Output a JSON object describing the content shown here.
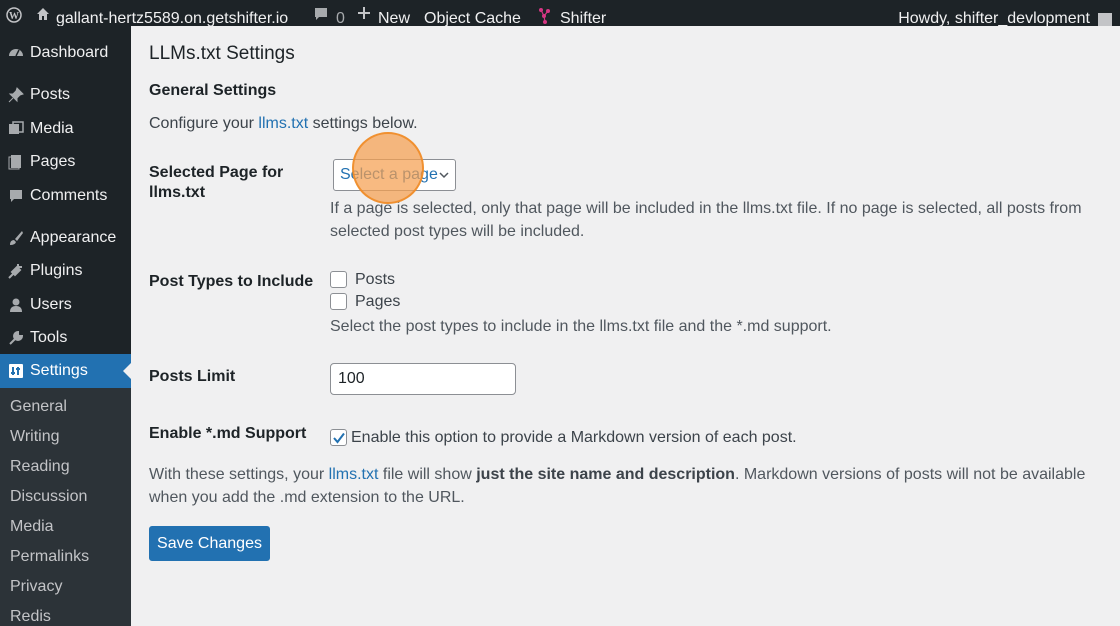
{
  "admin_bar": {
    "site_name": "gallant-hertz5589.on.getshifter.io",
    "comment_count": "0",
    "new_label": "New",
    "object_cache_label": "Object Cache",
    "shifter_label": "Shifter",
    "howdy_label": "Howdy, shifter_devlopment"
  },
  "sidebar": {
    "items": [
      {
        "label": "Dashboard",
        "icon": "dashboard-icon"
      },
      {
        "label": "Posts",
        "icon": "pin-icon"
      },
      {
        "label": "Media",
        "icon": "media-icon"
      },
      {
        "label": "Pages",
        "icon": "pages-icon"
      },
      {
        "label": "Comments",
        "icon": "comment-icon"
      },
      {
        "label": "Appearance",
        "icon": "brush-icon"
      },
      {
        "label": "Plugins",
        "icon": "plug-icon"
      },
      {
        "label": "Users",
        "icon": "user-icon"
      },
      {
        "label": "Tools",
        "icon": "wrench-icon"
      },
      {
        "label": "Settings",
        "icon": "settings-icon"
      }
    ],
    "submenu": [
      "General",
      "Writing",
      "Reading",
      "Discussion",
      "Media",
      "Permalinks",
      "Privacy",
      "Redis"
    ]
  },
  "page": {
    "title": "LLMs.txt Settings",
    "section_title": "General Settings",
    "intro_before": "Configure your ",
    "intro_link": "llms.txt",
    "intro_after": " settings below.",
    "selected_page": {
      "label_line1": "Selected Page for",
      "label_line2": "llms.txt",
      "placeholder": "Select a page",
      "desc_line1": "If a page is selected, only that page will be included in the llms.txt file. If no page is selected, all posts from",
      "desc_line2": "selected post types will be included."
    },
    "post_types": {
      "label": "Post Types to Include",
      "options": [
        {
          "label": "Posts",
          "checked": false
        },
        {
          "label": "Pages",
          "checked": false
        }
      ],
      "desc": "Select the post types to include in the llms.txt file and the *.md support."
    },
    "posts_limit": {
      "label": "Posts Limit",
      "value": "100"
    },
    "md_support": {
      "label": "Enable *.md Support",
      "checked": true,
      "option_label": "Enable this option to provide a Markdown version of each post."
    },
    "summary": {
      "before": "With these settings, your ",
      "link": "llms.txt",
      "middle": " file will show ",
      "bold": "just the site name and description",
      "after": ". Markdown versions of posts will not be available",
      "line2": "when you add the .md extension to the URL."
    },
    "save_label": "Save Changes"
  },
  "colors": {
    "admin_dark": "#1d2327",
    "submenu_bg": "#2c3338",
    "accent": "#2271b1",
    "content_bg": "#f0f0f1"
  }
}
